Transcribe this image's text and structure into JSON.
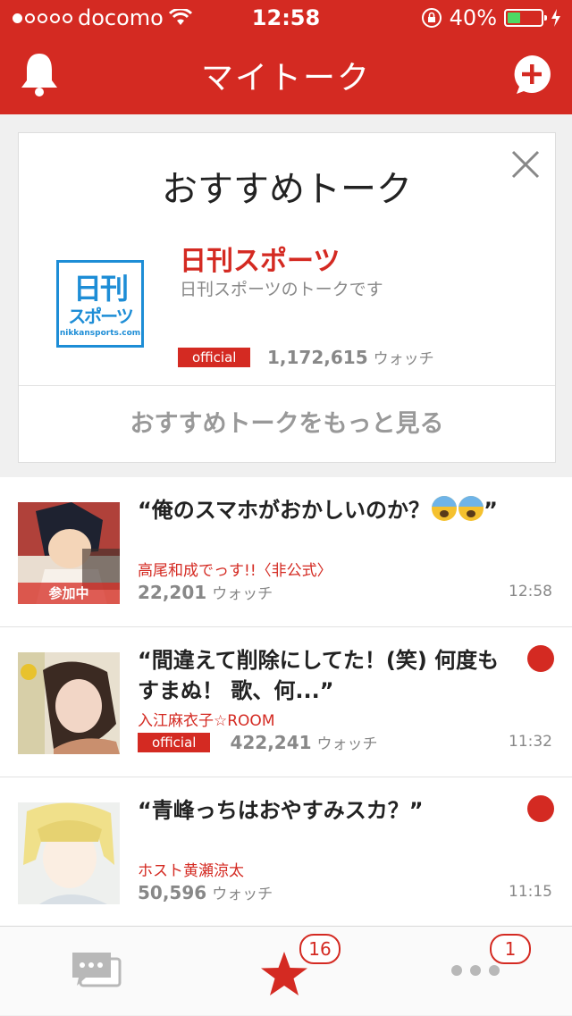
{
  "status_bar": {
    "carrier": "docomo",
    "time": "12:58",
    "battery": "40%",
    "battery_level": 0.4
  },
  "header": {
    "title": "マイトーク",
    "bell_icon": "bell-icon",
    "compose_icon": "add-chat-icon"
  },
  "recommend": {
    "title": "おすすめトーク",
    "logo": {
      "line1": "日刊",
      "line2": "スポーツ",
      "line3": "nikkansports.com"
    },
    "name": "日刊スポーツ",
    "description": "日刊スポーツのトークです",
    "badge": "official",
    "watch_count": "1,172,615",
    "watch_unit": "ウォッチ",
    "more_label": "おすすめトークをもっと見る"
  },
  "talks": [
    {
      "title": "“俺のスマホがおかしいのか？",
      "title_suffix": "”",
      "emoji_count": 2,
      "owner": "高尾和成でっす!!〈非公式〉",
      "watch_count": "22,201",
      "watch_unit": "ウォッチ",
      "time": "12:58",
      "joined_label": "参加中",
      "unread": false
    },
    {
      "title": "“間違えて削除にしてた！(笑) 何度もすまぬ！ 歌、何...”",
      "owner": "入江麻衣子☆ROOM",
      "badge": "official",
      "watch_count": "422,241",
      "watch_unit": "ウォッチ",
      "time": "11:32",
      "unread": true
    },
    {
      "title": "“青峰っちはおやすみスカ？”",
      "owner": "ホスト黄瀬涼太",
      "watch_count": "50,596",
      "watch_unit": "ウォッチ",
      "time": "11:15",
      "unread": true
    }
  ],
  "tabbar": {
    "tabs": [
      {
        "icon": "chat-icon",
        "badge": ""
      },
      {
        "icon": "star-icon",
        "badge": "16"
      },
      {
        "icon": "more-icon",
        "badge": "1"
      }
    ]
  },
  "colors": {
    "brand_red": "#d42a22",
    "battery_green": "#4cd964"
  }
}
